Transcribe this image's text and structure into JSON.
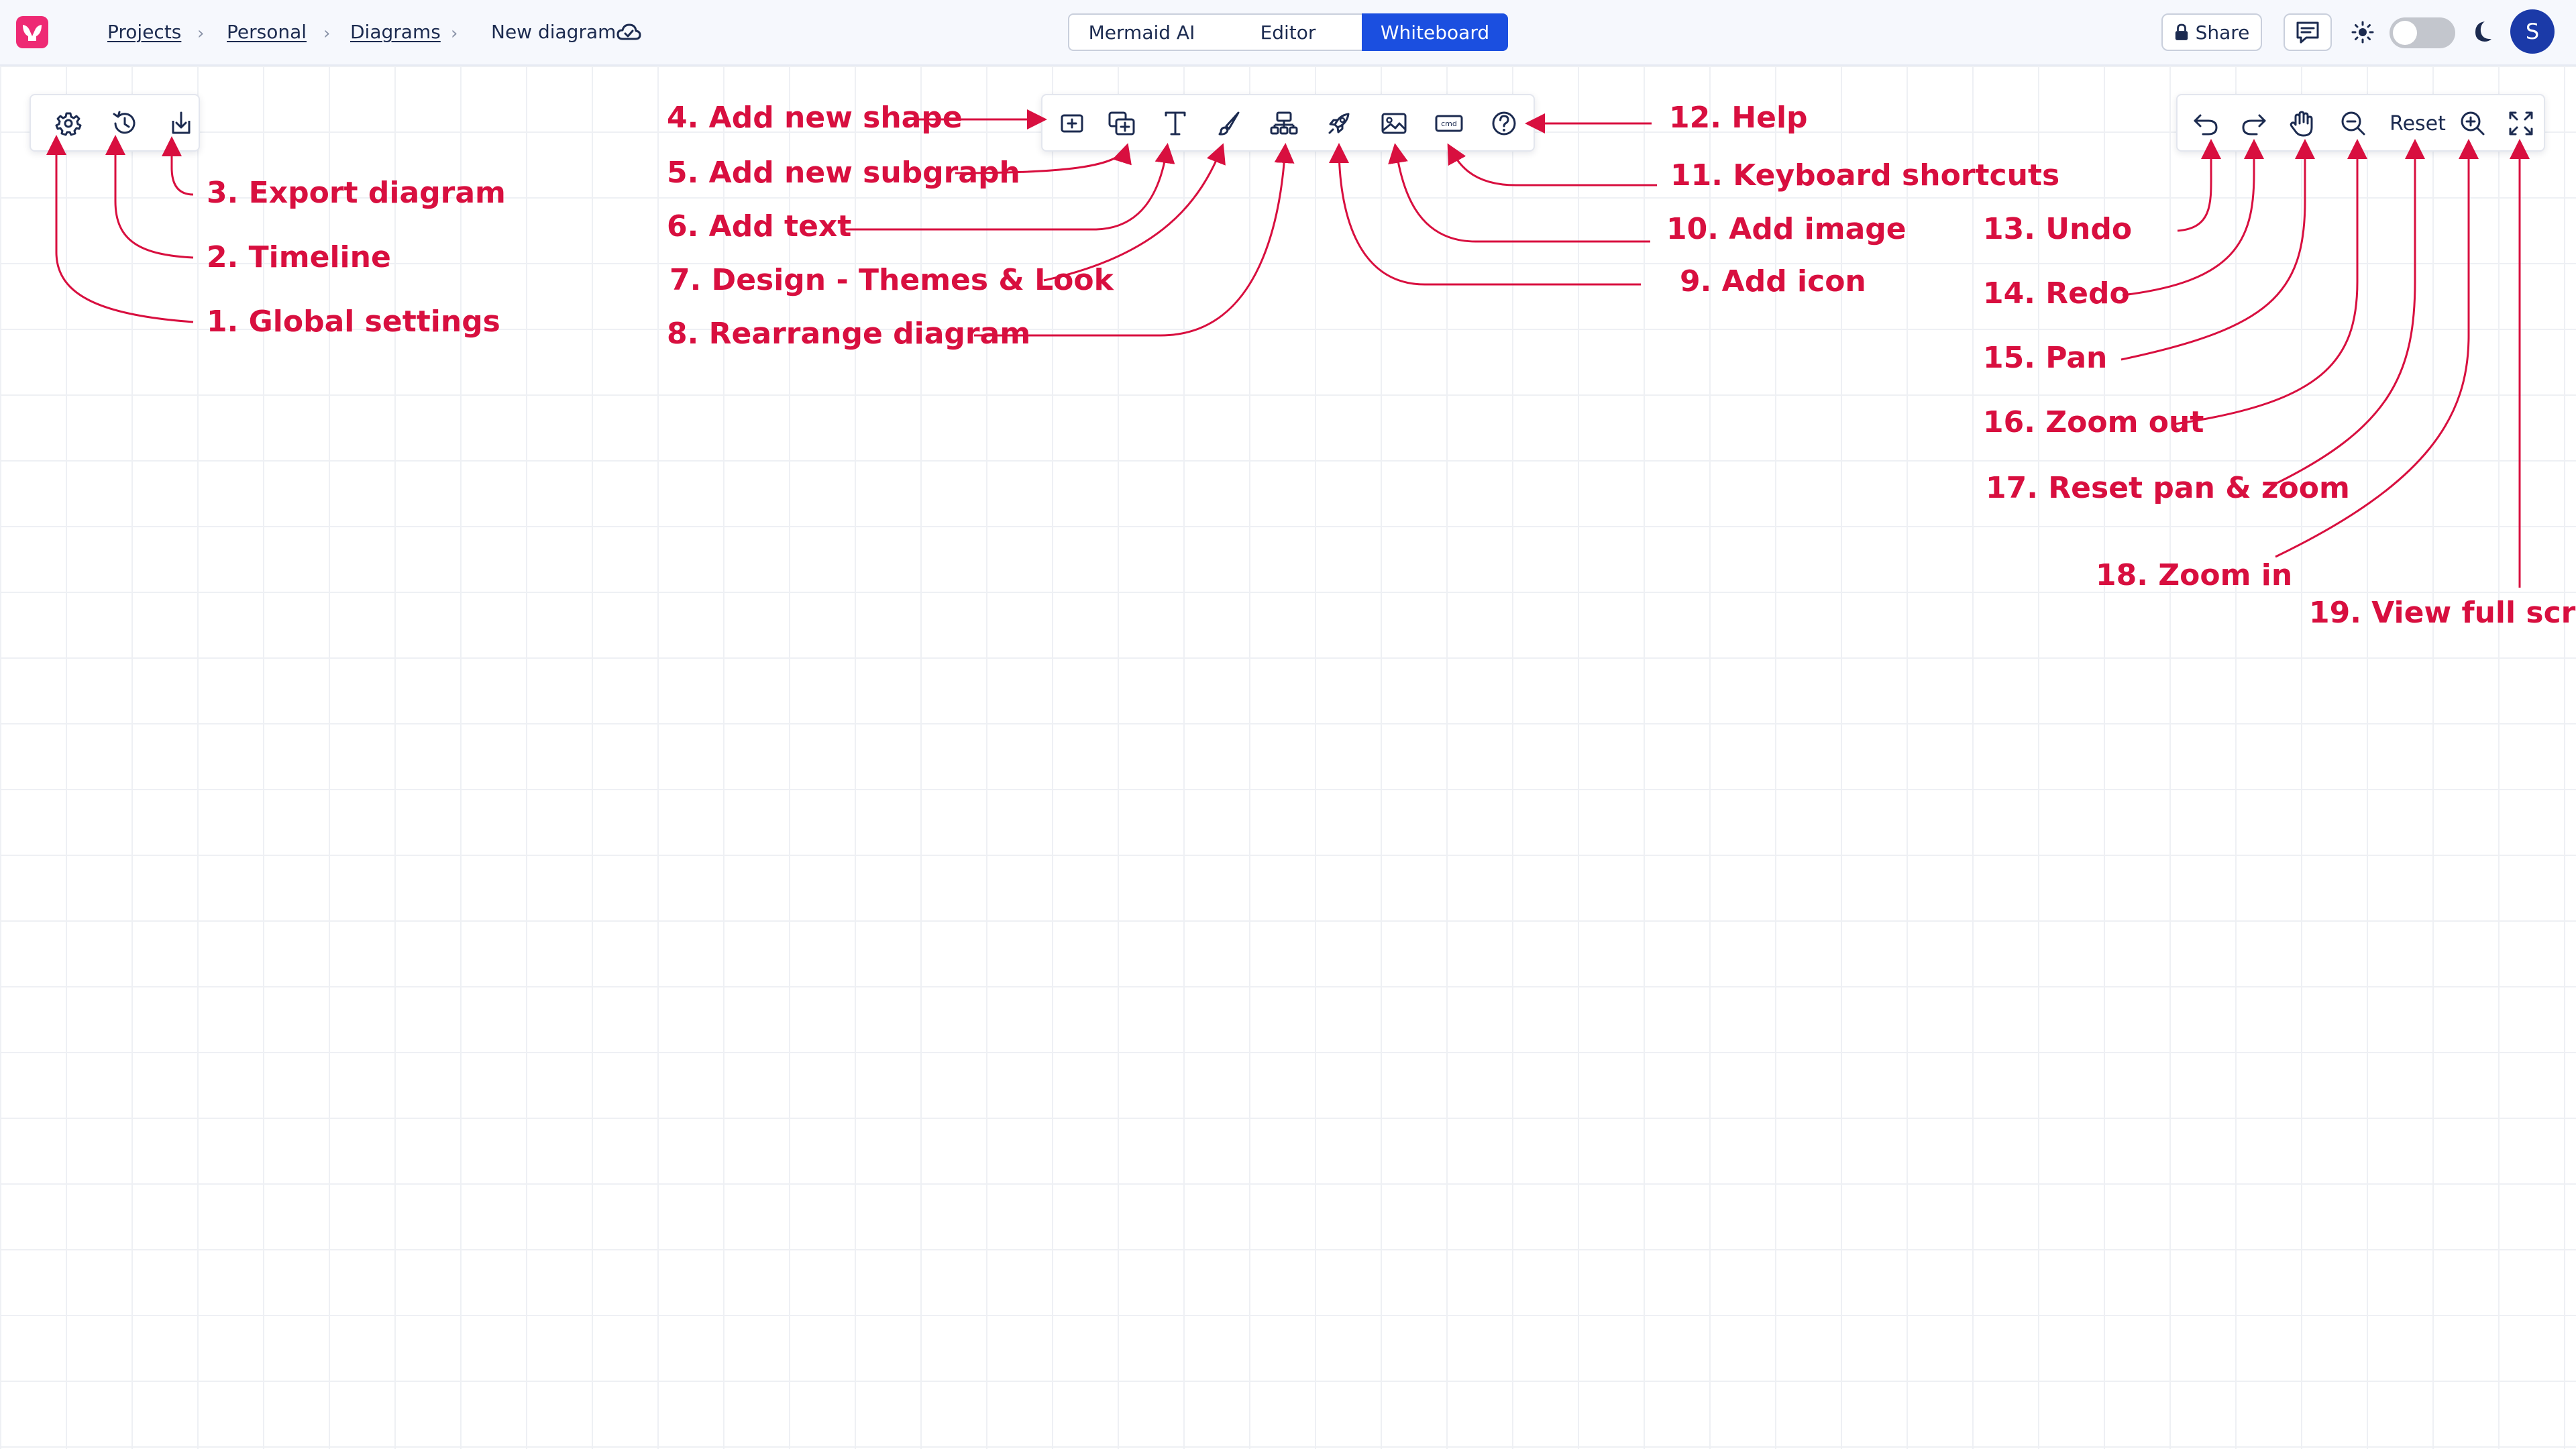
{
  "header": {
    "breadcrumbs": [
      {
        "label": "Projects"
      },
      {
        "label": "Personal"
      },
      {
        "label": "Diagrams"
      },
      {
        "label": "New diagram"
      }
    ],
    "separator": "›",
    "view_tabs": [
      {
        "label": "Mermaid AI",
        "active": false
      },
      {
        "label": "Editor",
        "active": false
      },
      {
        "label": "Whiteboard",
        "active": true
      }
    ],
    "share_label": "Share",
    "avatar_initial": "S",
    "theme_toggle": "off"
  },
  "left_toolbar": {
    "tools": [
      "gear-icon",
      "history-icon",
      "export-icon"
    ]
  },
  "center_toolbar": {
    "tools": [
      "add-shape-icon",
      "add-subgraph-icon",
      "text-icon",
      "brush-icon",
      "rearrange-icon",
      "rocket-icon",
      "image-icon",
      "cmd-icon",
      "help-icon"
    ],
    "cmd_text": "cmd"
  },
  "right_toolbar": {
    "reset_label": "Reset",
    "tools": [
      "undo-icon",
      "redo-icon",
      "hand-icon",
      "zoom-out-icon",
      "zoom-in-icon",
      "fullscreen-icon"
    ]
  },
  "annotations": [
    {
      "num": "1.",
      "text": "Global settings"
    },
    {
      "num": "2.",
      "text": "Timeline"
    },
    {
      "num": "3.",
      "text": "Export diagram"
    },
    {
      "num": "4.",
      "text": "Add new shape"
    },
    {
      "num": "5.",
      "text": "Add new subgraph"
    },
    {
      "num": "6.",
      "text": "Add text"
    },
    {
      "num": "7.",
      "text": "Design - Themes & Look"
    },
    {
      "num": "8.",
      "text": "Rearrange diagram"
    },
    {
      "num": "9.",
      "text": "Add icon"
    },
    {
      "num": "10.",
      "text": "Add image"
    },
    {
      "num": "11.",
      "text": "Keyboard shortcuts"
    },
    {
      "num": "12.",
      "text": "Help"
    },
    {
      "num": "13.",
      "text": "Undo"
    },
    {
      "num": "14.",
      "text": "Redo"
    },
    {
      "num": "15.",
      "text": "Pan"
    },
    {
      "num": "16.",
      "text": "Zoom out"
    },
    {
      "num": "17.",
      "text": "Reset pan & zoom"
    },
    {
      "num": "18.",
      "text": "Zoom in"
    },
    {
      "num": "19.",
      "text": "View full screen"
    }
  ],
  "colors": {
    "annotation": "#d80f3f",
    "brand": "#ee2a74",
    "active_tab": "#1b4fe0",
    "icon": "#1c2b50"
  }
}
